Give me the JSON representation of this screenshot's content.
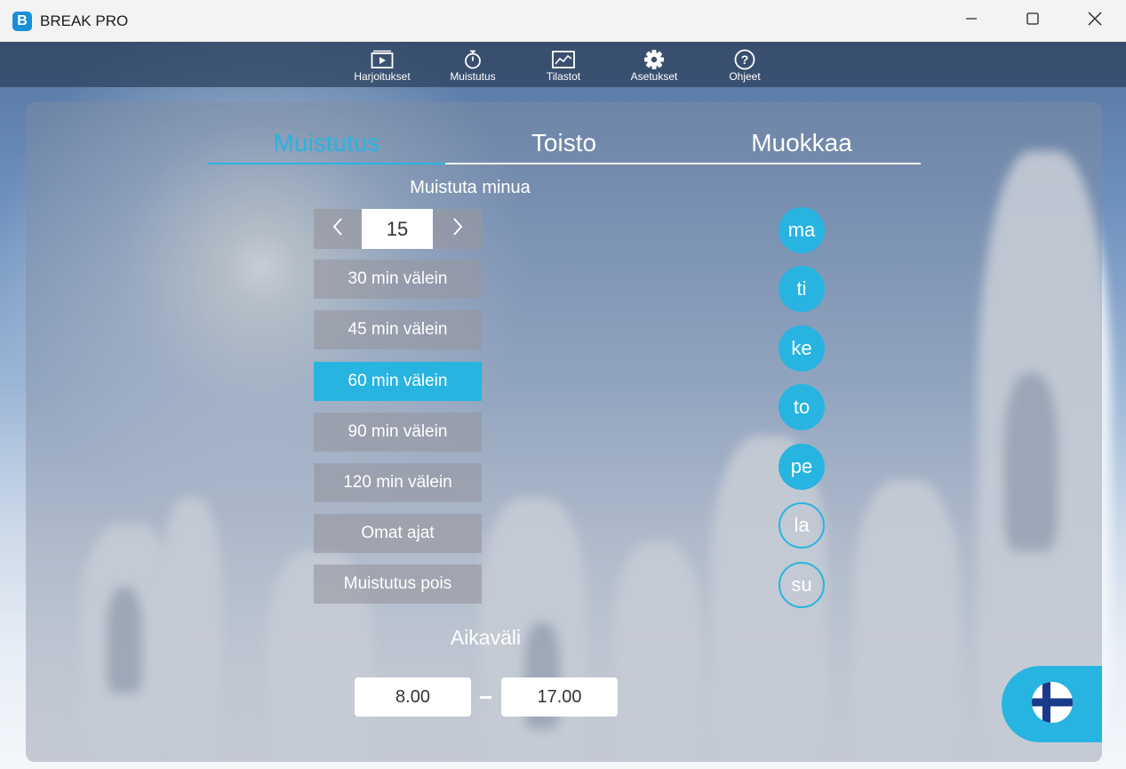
{
  "window": {
    "title": "BREAK PRO",
    "logo_letter": "B"
  },
  "nav": {
    "items": [
      {
        "label": "Harjoitukset",
        "icon": "video-icon"
      },
      {
        "label": "Muistutus",
        "icon": "stopwatch-icon"
      },
      {
        "label": "Tilastot",
        "icon": "chart-icon"
      },
      {
        "label": "Asetukset",
        "icon": "gear-icon"
      },
      {
        "label": "Ohjeet",
        "icon": "help-icon"
      }
    ]
  },
  "tabs": [
    {
      "label": "Muistutus",
      "active": true
    },
    {
      "label": "Toisto",
      "active": false
    },
    {
      "label": "Muokkaa",
      "active": false
    }
  ],
  "reminder": {
    "label": "Muistuta minua",
    "stepper_value": "15",
    "options": [
      {
        "label": "30 min välein",
        "selected": false
      },
      {
        "label": "45 min välein",
        "selected": false
      },
      {
        "label": "60 min välein",
        "selected": true
      },
      {
        "label": "90 min välein",
        "selected": false
      },
      {
        "label": "120 min välein",
        "selected": false
      },
      {
        "label": "Omat ajat",
        "selected": false
      },
      {
        "label": "Muistutus pois",
        "selected": false
      }
    ]
  },
  "days": [
    {
      "label": "ma",
      "enabled": true
    },
    {
      "label": "ti",
      "enabled": true
    },
    {
      "label": "ke",
      "enabled": true
    },
    {
      "label": "to",
      "enabled": true
    },
    {
      "label": "pe",
      "enabled": true
    },
    {
      "label": "la",
      "enabled": false
    },
    {
      "label": "su",
      "enabled": false
    }
  ],
  "time_range": {
    "label": "Aikaväli",
    "start": "8.00",
    "end": "17.00"
  },
  "language": {
    "flag": "finland-flag-icon"
  },
  "colors": {
    "accent": "#28b4e0",
    "nav_bg": "#2d415f"
  }
}
